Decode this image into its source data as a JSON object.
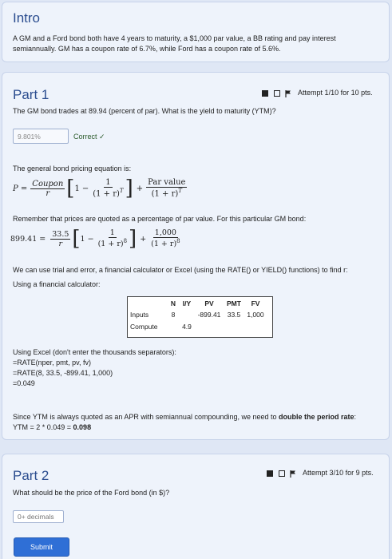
{
  "intro": {
    "title": "Intro",
    "text_line1": "A GM and a Ford bond both have 4 years to maturity, a $1,000 par value, a BB rating and pay interest",
    "text_line2": "semiannually. GM has a coupon rate of 6.7%, while Ford has a coupon rate of 5.6%."
  },
  "part1": {
    "title": "Part 1",
    "attempt": "Attempt 1/10 for 10 pts.",
    "question": "The GM bond trades at 89.94 (percent of par). What is the yield to maturity (YTM)?",
    "answer_value": "9.801%",
    "status": "Correct ✓",
    "pricing_eq_intro": "The general bond pricing equation is:",
    "eq_P": "P =",
    "eq_coupon": "Coupon",
    "eq_r": "r",
    "eq_one": "1",
    "eq_one_plus_r_T": "(1 + r)",
    "eq_T": "T",
    "eq_par_value": "Par value",
    "remember": "Remember that prices are quoted as a percentage of par value. For this particular GM bond:",
    "gm_price": "899.41 =",
    "gm_coupon": "33.5",
    "gm_par": "1,000",
    "gm_exp": "8",
    "trial": "We can use trial and error, a financial calculator or Excel (using the RATE() or YIELD() functions) to find r:",
    "using_calc": "Using a financial calculator:",
    "calc_headers": [
      "",
      "N",
      "I/Y",
      "PV",
      "PMT",
      "FV"
    ],
    "calc_inputs": [
      "Inputs",
      "8",
      "",
      "-899.41",
      "33.5",
      "1,000"
    ],
    "calc_compute": [
      "Compute",
      "",
      "4.9",
      "",
      "",
      ""
    ],
    "excel_intro": "Using Excel (don't enter the thousands separators):",
    "excel_line1": "=RATE(nper, pmt, pv, fv)",
    "excel_line2": "=RATE(8, 33.5, -899.41, 1,000)",
    "excel_line3": "=0.049",
    "since_ytm_a": "Since YTM is always quoted as an APR with semiannual compounding, we need to ",
    "since_ytm_b": "double the period rate",
    "since_ytm_c": ":",
    "ytm_formula": "YTM = 2 * 0.049 = ",
    "ytm_result": "0.098"
  },
  "part2": {
    "title": "Part 2",
    "attempt": "Attempt 3/10 for 9 pts.",
    "question": "What should be the price of the Ford bond (in $)?",
    "placeholder": "0+ decimals",
    "submit": "Submit"
  }
}
